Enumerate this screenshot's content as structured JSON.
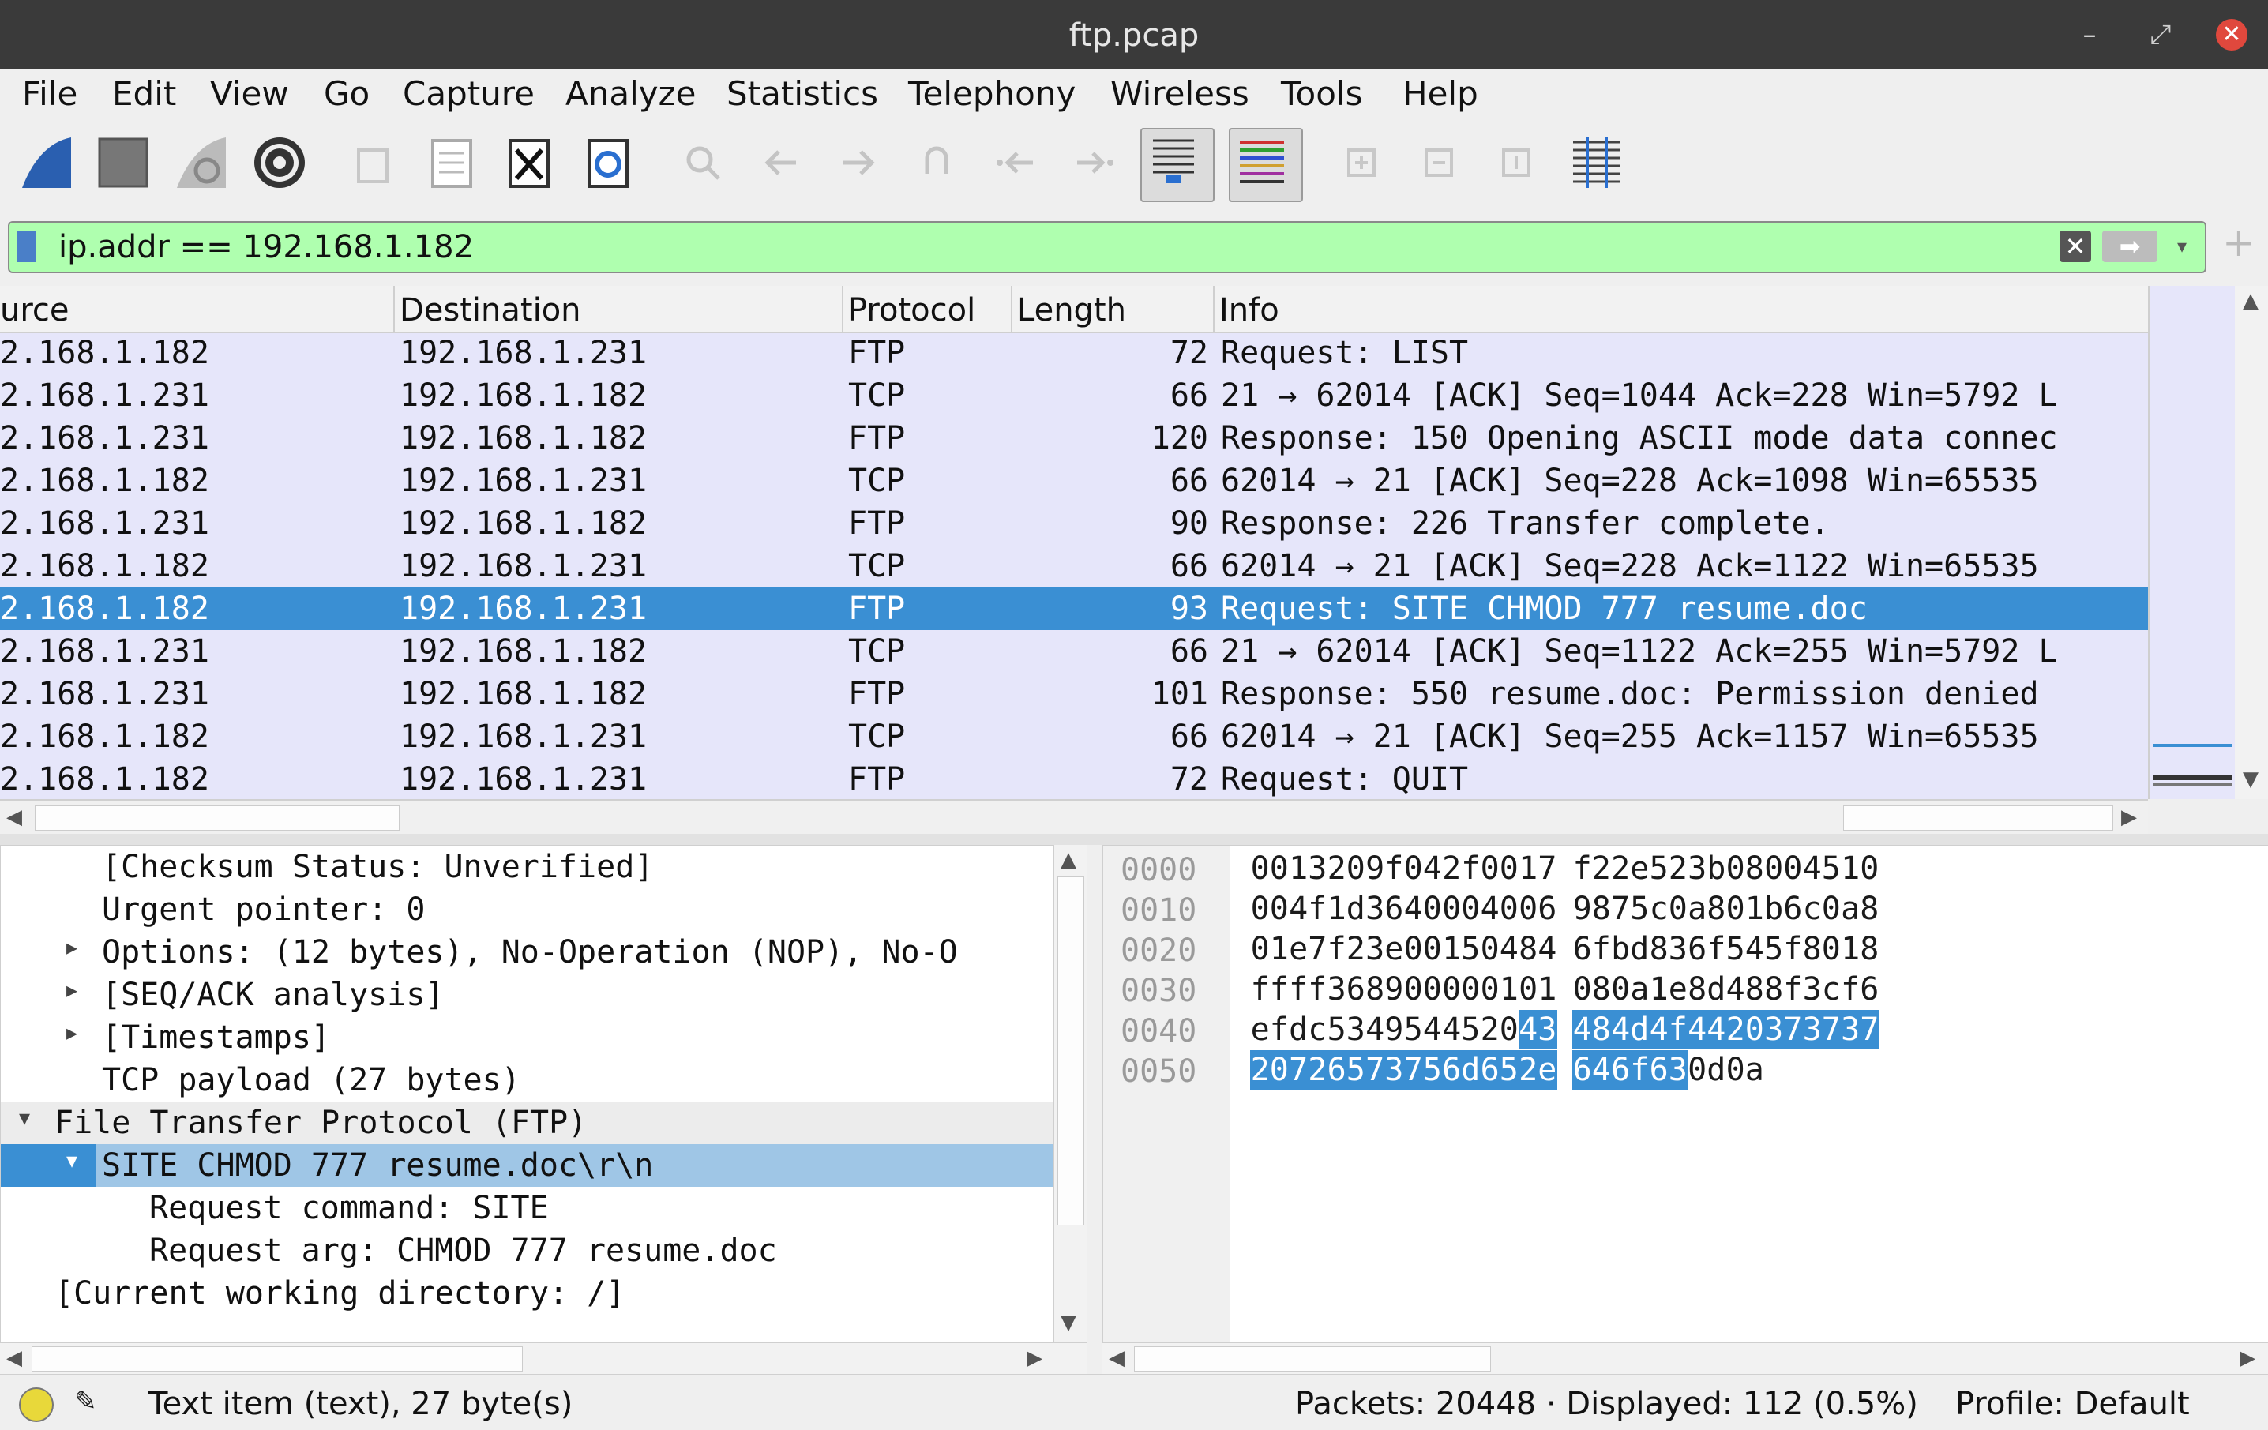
{
  "window": {
    "title": "ftp.pcap"
  },
  "menu": [
    "File",
    "Edit",
    "View",
    "Go",
    "Capture",
    "Analyze",
    "Statistics",
    "Telephony",
    "Wireless",
    "Tools",
    "Help"
  ],
  "filter": {
    "value": "ip.addr == 192.168.1.182"
  },
  "columns": {
    "source": "urce",
    "destination": "Destination",
    "protocol": "Protocol",
    "length": "Length",
    "info": "Info"
  },
  "packets": [
    {
      "src": "2.168.1.182",
      "dst": "192.168.1.231",
      "proto": "FTP",
      "len": "72",
      "info": "Request: LIST"
    },
    {
      "src": "2.168.1.231",
      "dst": "192.168.1.182",
      "proto": "TCP",
      "len": "66",
      "info": "21 → 62014 [ACK] Seq=1044 Ack=228 Win=5792 L"
    },
    {
      "src": "2.168.1.231",
      "dst": "192.168.1.182",
      "proto": "FTP",
      "len": "120",
      "info": "Response: 150 Opening ASCII mode data connec"
    },
    {
      "src": "2.168.1.182",
      "dst": "192.168.1.231",
      "proto": "TCP",
      "len": "66",
      "info": "62014 → 21 [ACK] Seq=228 Ack=1098 Win=65535"
    },
    {
      "src": "2.168.1.231",
      "dst": "192.168.1.182",
      "proto": "FTP",
      "len": "90",
      "info": "Response: 226 Transfer complete."
    },
    {
      "src": "2.168.1.182",
      "dst": "192.168.1.231",
      "proto": "TCP",
      "len": "66",
      "info": "62014 → 21 [ACK] Seq=228 Ack=1122 Win=65535"
    },
    {
      "src": "2.168.1.182",
      "dst": "192.168.1.231",
      "proto": "FTP",
      "len": "93",
      "info": "Request: SITE CHMOD 777 resume.doc"
    },
    {
      "src": "2.168.1.231",
      "dst": "192.168.1.182",
      "proto": "TCP",
      "len": "66",
      "info": "21 → 62014 [ACK] Seq=1122 Ack=255 Win=5792 L"
    },
    {
      "src": "2.168.1.231",
      "dst": "192.168.1.182",
      "proto": "FTP",
      "len": "101",
      "info": "Response: 550 resume.doc: Permission denied"
    },
    {
      "src": "2.168.1.182",
      "dst": "192.168.1.231",
      "proto": "TCP",
      "len": "66",
      "info": "62014 → 21 [ACK] Seq=255 Ack=1157 Win=65535"
    },
    {
      "src": "2.168.1.182",
      "dst": "192.168.1.231",
      "proto": "FTP",
      "len": "72",
      "info": "Request: QUIT"
    }
  ],
  "details": [
    "[Checksum Status: Unverified]",
    "Urgent pointer: 0",
    "Options: (12 bytes), No-Operation (NOP), No-O",
    "[SEQ/ACK analysis]",
    "[Timestamps]",
    "TCP payload (27 bytes)",
    "File Transfer Protocol (FTP)",
    "SITE CHMOD 777 resume.doc\\r\\n",
    "Request command: SITE",
    "Request arg: CHMOD 777 resume.doc",
    "[Current working directory: /]"
  ],
  "hex": [
    {
      "off": "0000",
      "bytes": [
        "00",
        "13",
        "20",
        "9f",
        "04",
        "2f",
        "00",
        "17",
        "f2",
        "2e",
        "52",
        "3b",
        "08",
        "00",
        "45",
        "10"
      ]
    },
    {
      "off": "0010",
      "bytes": [
        "00",
        "4f",
        "1d",
        "36",
        "40",
        "00",
        "40",
        "06",
        "98",
        "75",
        "c0",
        "a8",
        "01",
        "b6",
        "c0",
        "a8"
      ]
    },
    {
      "off": "0020",
      "bytes": [
        "01",
        "e7",
        "f2",
        "3e",
        "00",
        "15",
        "04",
        "84",
        "6f",
        "bd",
        "83",
        "6f",
        "54",
        "5f",
        "80",
        "18"
      ]
    },
    {
      "off": "0030",
      "bytes": [
        "ff",
        "ff",
        "36",
        "89",
        "00",
        "00",
        "01",
        "01",
        "08",
        "0a",
        "1e",
        "8d",
        "48",
        "8f",
        "3c",
        "f6"
      ]
    },
    {
      "off": "0040",
      "bytes": [
        "ef",
        "dc",
        "53",
        "49",
        "54",
        "45",
        "20",
        "43",
        "48",
        "4d",
        "4f",
        "44",
        "20",
        "37",
        "37",
        "37"
      ]
    },
    {
      "off": "0050",
      "bytes": [
        "20",
        "72",
        "65",
        "73",
        "75",
        "6d",
        "65",
        "2e",
        "64",
        "6f",
        "63",
        "0d",
        "0a"
      ]
    }
  ],
  "status": {
    "item": "Text item (text), 27 byte(s)",
    "packets": "Packets: 20448 · Displayed: 112 (0.5%)",
    "profile": "Profile: Default"
  },
  "colors": {
    "selected": "#3a8fd3",
    "row_bg": "#e6e6fa",
    "filter_ok": "#afffaf"
  }
}
